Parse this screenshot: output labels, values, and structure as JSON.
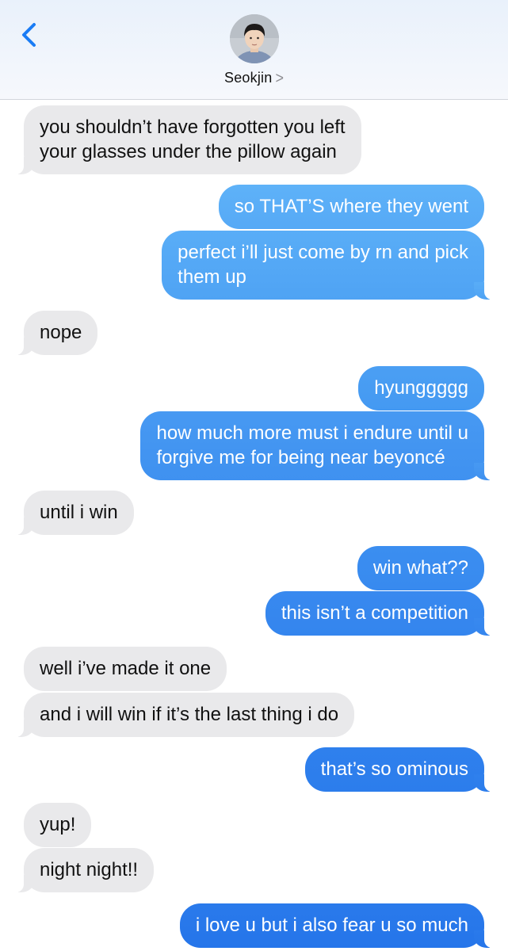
{
  "header": {
    "back_icon": "chevron-left-icon",
    "contact_name": "Seokjin",
    "contact_chevron": ">",
    "accent_color": "#1a7cf5"
  },
  "messages": [
    {
      "side": "in",
      "lines": [
        "you shouldn’t have forgotten you left",
        "your glasses under the pillow again"
      ]
    },
    {
      "side": "out",
      "lines": [
        "so THAT’S where they went"
      ]
    },
    {
      "side": "out",
      "lines": [
        "perfect i’ll just come by rn and pick",
        "them up"
      ]
    },
    {
      "side": "in",
      "lines": [
        "nope"
      ]
    },
    {
      "side": "out",
      "lines": [
        "hyunggggg"
      ]
    },
    {
      "side": "out",
      "lines": [
        "how much more must i endure until u",
        "forgive me for being near beyoncé"
      ]
    },
    {
      "side": "in",
      "lines": [
        "until i win"
      ]
    },
    {
      "side": "out",
      "lines": [
        "win what??"
      ]
    },
    {
      "side": "out",
      "lines": [
        "this isn’t a competition"
      ]
    },
    {
      "side": "in",
      "lines": [
        "well i’ve made it one"
      ]
    },
    {
      "side": "in",
      "lines": [
        "and i will win if it’s the last thing i do"
      ]
    },
    {
      "side": "out",
      "lines": [
        "that’s so ominous"
      ]
    },
    {
      "side": "in",
      "lines": [
        "yup!"
      ]
    },
    {
      "side": "in",
      "lines": [
        "night night!!"
      ]
    },
    {
      "side": "out",
      "lines": [
        "i love u but i also fear u so much"
      ]
    }
  ],
  "colors": {
    "incoming_bubble": "#e9e9eb",
    "outgoing_gradient_top": "#5eb2f8",
    "outgoing_gradient_bottom": "#1e74e8"
  }
}
